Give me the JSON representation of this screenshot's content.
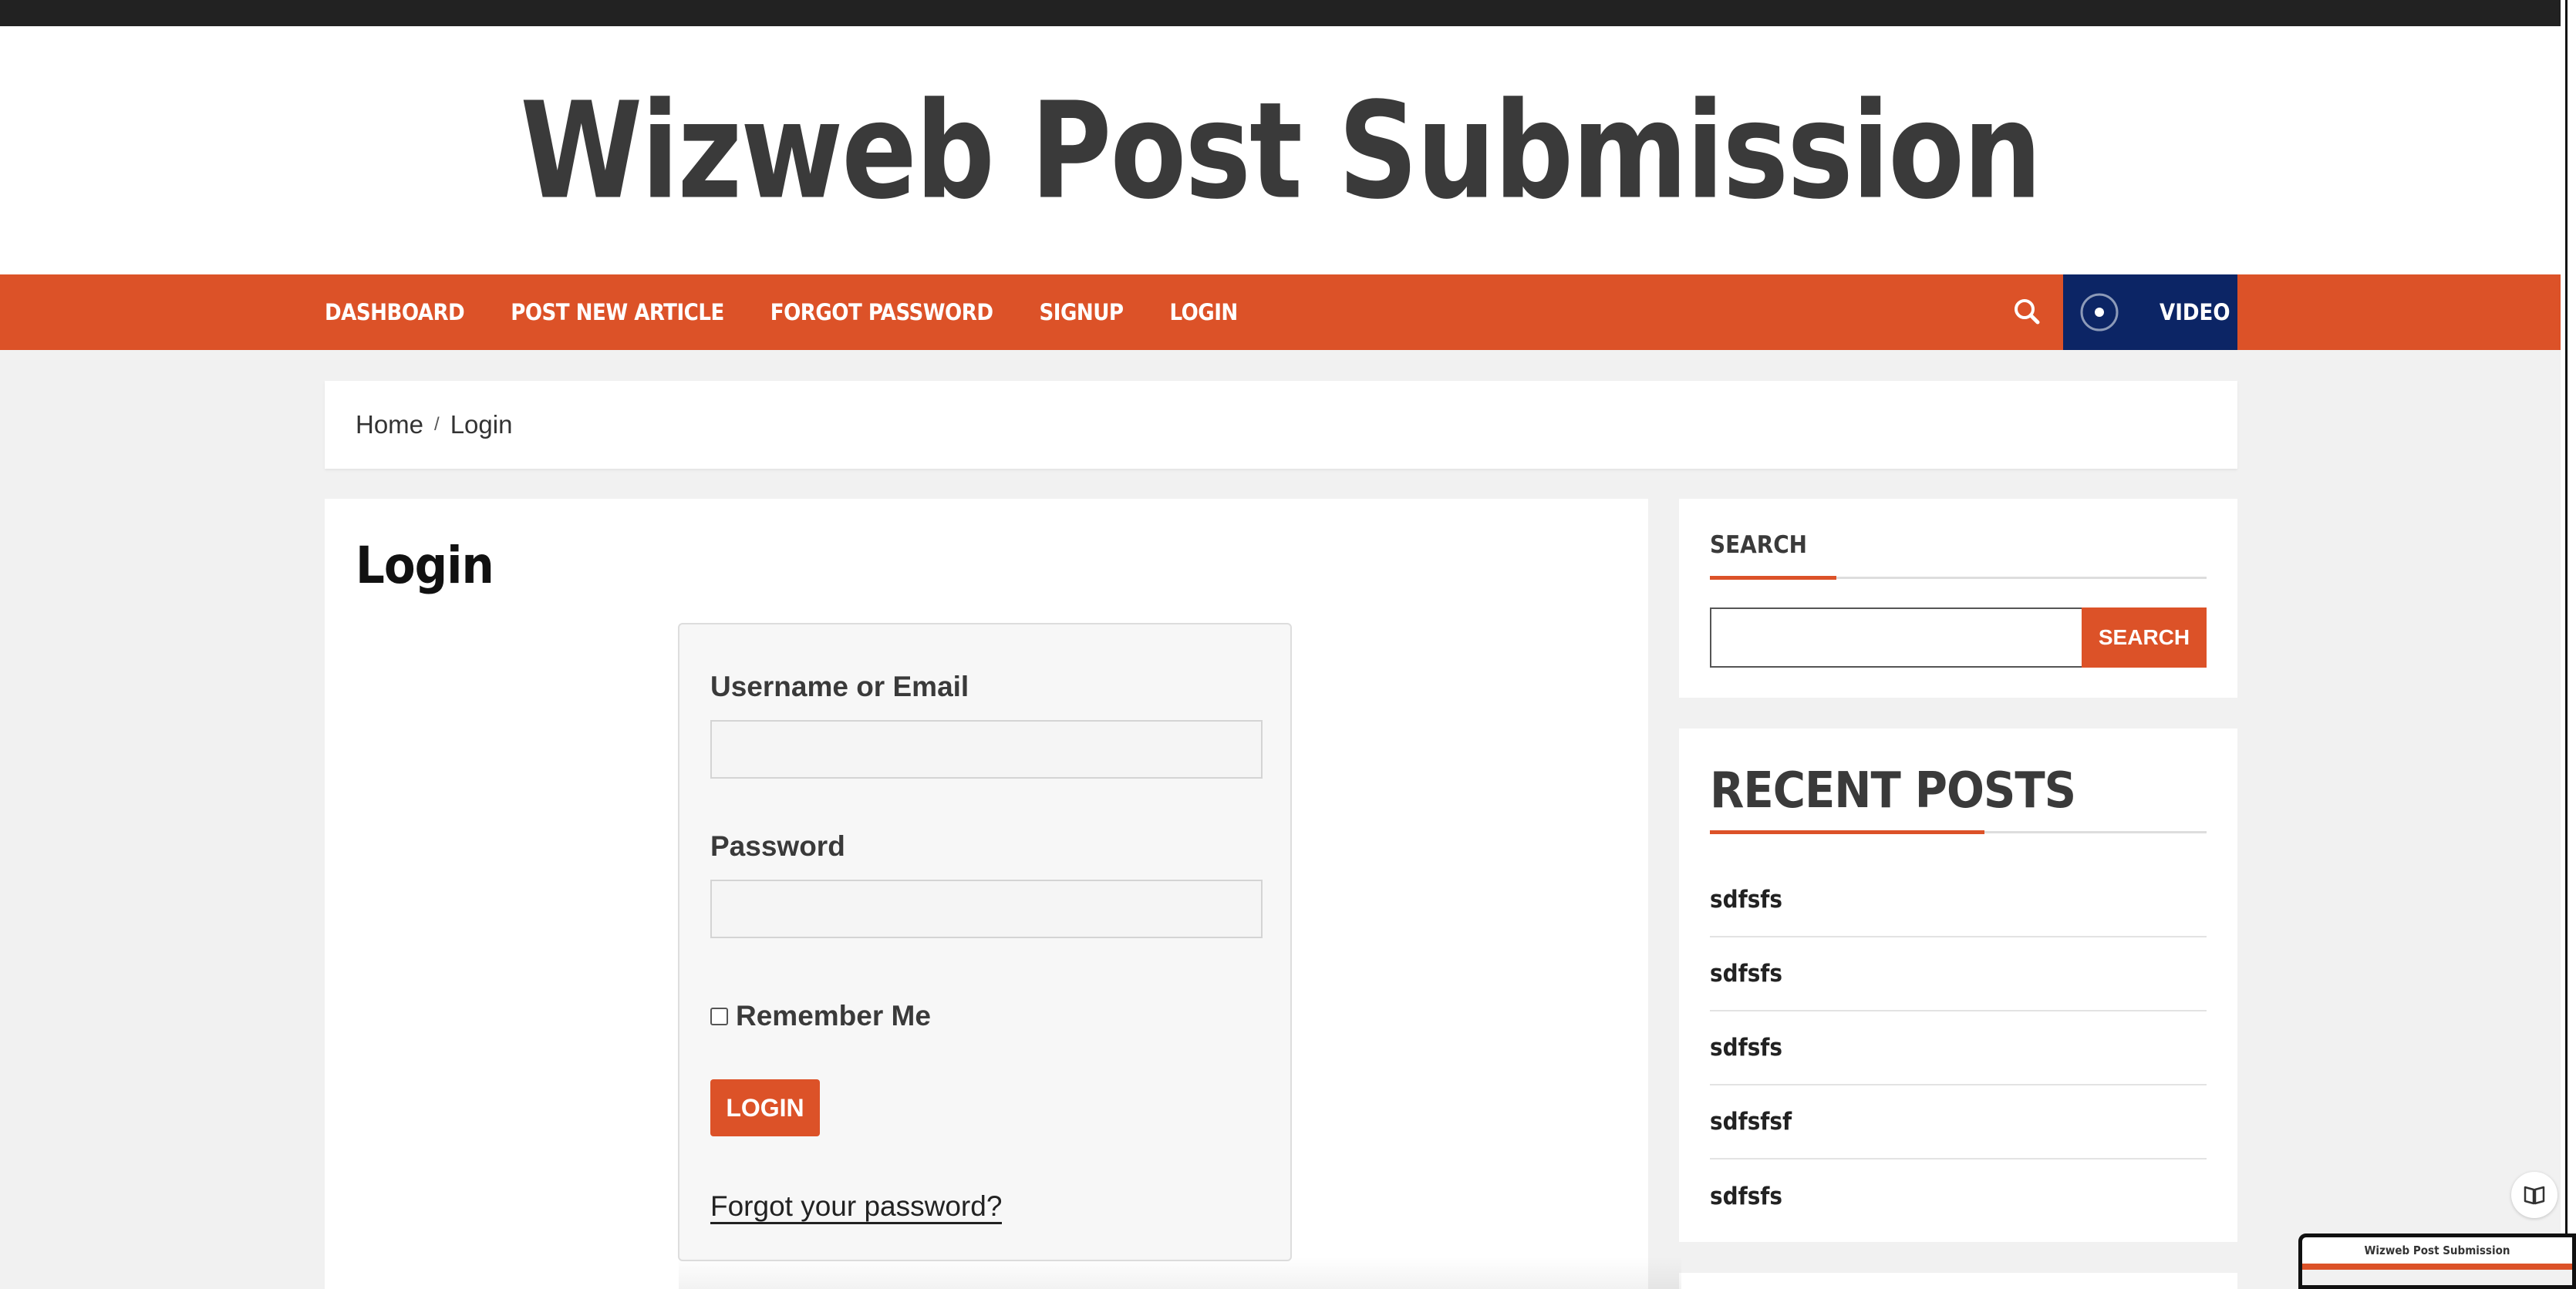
{
  "site": {
    "title": "Wizweb Post Submission"
  },
  "nav": {
    "items": [
      "DASHBOARD",
      "POST NEW ARTICLE",
      "FORGOT PASSWORD",
      "SIGNUP",
      "LOGIN"
    ],
    "search_icon": "search-icon",
    "video_label": "VIDEO",
    "video_icon": "record-icon"
  },
  "breadcrumb": {
    "items": [
      "Home",
      "Login"
    ],
    "separator": "/"
  },
  "main": {
    "title": "Login",
    "form": {
      "username_label": "Username or Email",
      "username_value": "",
      "password_label": "Password",
      "password_value": "",
      "remember_label": "Remember Me",
      "remember_checked": false,
      "submit_label": "LOGIN",
      "forgot_link": "Forgot your password?"
    }
  },
  "sidebar": {
    "search": {
      "title": "SEARCH",
      "input_value": "",
      "button_label": "SEARCH"
    },
    "recent_posts": {
      "title": "RECENT POSTS",
      "items": [
        "sdfsfs",
        "sdfsfs",
        "sdfsfs",
        "sdfsfsf",
        "sdfsfs"
      ]
    }
  },
  "thumbnail": {
    "title": "Wizweb Post Submission"
  },
  "colors": {
    "accent": "#dc5228",
    "navy": "#0c2565",
    "topbar": "#222222",
    "background": "#f1f1f1"
  }
}
